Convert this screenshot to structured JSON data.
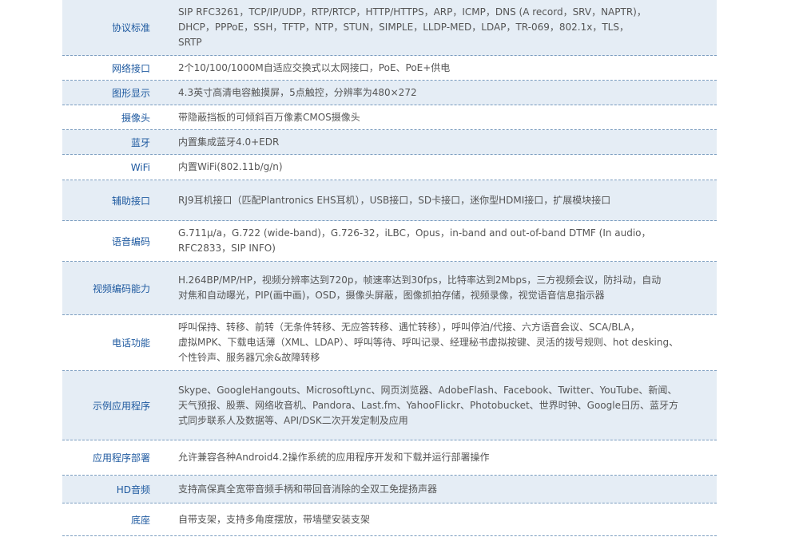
{
  "rows": [
    {
      "label": "协议标准",
      "value": "SIP RFC3261，TCP/IP/UDP，RTP/RTCP，HTTP/HTTPS，ARP，ICMP，DNS (A record，SRV，NAPTR)，\nDHCP，PPPoE，SSH，TFTP，NTP，STUN，SIMPLE，LLDP-MED，LDAP，TR-069，802.1x，TLS，\nSRTP"
    },
    {
      "label": "网络接口",
      "value": "2个10/100/1000M自适应交换式以太网接口，PoE、PoE+供电"
    },
    {
      "label": "图形显示",
      "value": "4.3英寸高清电容触摸屏，5点触控，分辨率为480×272"
    },
    {
      "label": "摄像头",
      "value": "带隐蔽挡板的可倾斜百万像素CMOS摄像头"
    },
    {
      "label": "蓝牙",
      "value": "内置集成蓝牙4.0+EDR"
    },
    {
      "label": "WiFi",
      "value": "内置WiFi(802.11b/g/n)"
    },
    {
      "label": "辅助接口",
      "value": "RJ9耳机接口（匹配Plantronics EHS耳机），USB接口，SD卡接口，迷你型HDMI接口，扩展模块接口"
    },
    {
      "label": "语音编码",
      "value": "G.711μ/a，G.722 (wide-band)，G.726-32，iLBC，Opus，in-band and out-of-band DTMF (In audio，\nRFC2833，SIP INFO)"
    },
    {
      "label": "视频编码能力",
      "value": "H.264BP/MP/HP，视频分辨率达到720p，帧速率达到30fps，比特率达到2Mbps，三方视频会议，防抖动，自动\n对焦和自动曝光，PIP(画中画)，OSD，摄像头屏蔽，图像抓拍存储，视频录像，视觉语音信息指示器"
    },
    {
      "label": "电话功能",
      "value": "呼叫保持、转移、前转（无条件转移、无应答转移、遇忙转移），呼叫停泊/代接、六方语音会议、SCA/BLA，\n虚拟MPK、下载电话薄（XML、LDAP）、呼叫等待、呼叫记录、经理秘书虚拟按键、灵活的拨号规则、hot desking、\n个性铃声、服务器冗余&故障转移"
    },
    {
      "label": "示例应用程序",
      "value": "Skype、GoogleHangouts、MicrosoftLync、网页浏览器、AdobeFlash、Facebook、Twitter、YouTube、新闻、\n天气预报、股票、网络收音机、Pandora、Last.fm、YahooFlickr、Photobucket、世界时钟、Google日历、蓝牙方\n式同步联系人及数据等、API/DSK二次开发定制及应用"
    },
    {
      "label": "应用程序部署",
      "value": "允许兼容各种Android4.2操作系统的应用程序开发和下载并运行部署操作"
    },
    {
      "label": "HD音频",
      "value": "支持高保真全宽带音频手柄和带回音消除的全双工免提扬声器"
    },
    {
      "label": "底座",
      "value": "自带支架，支持多角度摆放，带墙壁安装支架"
    }
  ]
}
